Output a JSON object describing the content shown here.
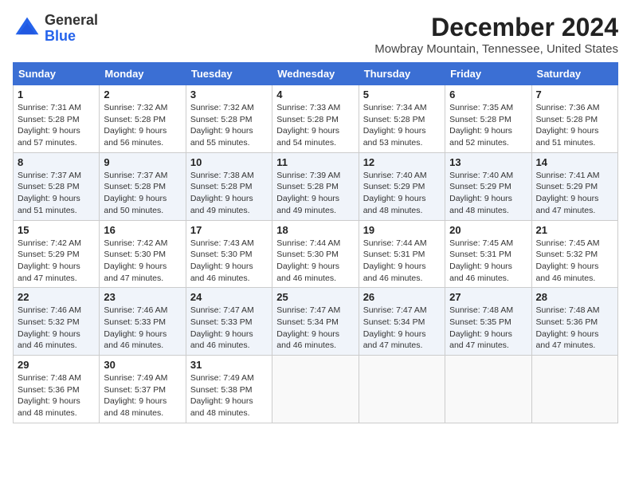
{
  "logo": {
    "general": "General",
    "blue": "Blue"
  },
  "header": {
    "month": "December 2024",
    "location": "Mowbray Mountain, Tennessee, United States"
  },
  "weekdays": [
    "Sunday",
    "Monday",
    "Tuesday",
    "Wednesday",
    "Thursday",
    "Friday",
    "Saturday"
  ],
  "weeks": [
    [
      {
        "day": "1",
        "sunrise": "7:31 AM",
        "sunset": "5:28 PM",
        "daylight": "9 hours and 57 minutes."
      },
      {
        "day": "2",
        "sunrise": "7:32 AM",
        "sunset": "5:28 PM",
        "daylight": "9 hours and 56 minutes."
      },
      {
        "day": "3",
        "sunrise": "7:32 AM",
        "sunset": "5:28 PM",
        "daylight": "9 hours and 55 minutes."
      },
      {
        "day": "4",
        "sunrise": "7:33 AM",
        "sunset": "5:28 PM",
        "daylight": "9 hours and 54 minutes."
      },
      {
        "day": "5",
        "sunrise": "7:34 AM",
        "sunset": "5:28 PM",
        "daylight": "9 hours and 53 minutes."
      },
      {
        "day": "6",
        "sunrise": "7:35 AM",
        "sunset": "5:28 PM",
        "daylight": "9 hours and 52 minutes."
      },
      {
        "day": "7",
        "sunrise": "7:36 AM",
        "sunset": "5:28 PM",
        "daylight": "9 hours and 51 minutes."
      }
    ],
    [
      {
        "day": "8",
        "sunrise": "7:37 AM",
        "sunset": "5:28 PM",
        "daylight": "9 hours and 51 minutes."
      },
      {
        "day": "9",
        "sunrise": "7:37 AM",
        "sunset": "5:28 PM",
        "daylight": "9 hours and 50 minutes."
      },
      {
        "day": "10",
        "sunrise": "7:38 AM",
        "sunset": "5:28 PM",
        "daylight": "9 hours and 49 minutes."
      },
      {
        "day": "11",
        "sunrise": "7:39 AM",
        "sunset": "5:28 PM",
        "daylight": "9 hours and 49 minutes."
      },
      {
        "day": "12",
        "sunrise": "7:40 AM",
        "sunset": "5:29 PM",
        "daylight": "9 hours and 48 minutes."
      },
      {
        "day": "13",
        "sunrise": "7:40 AM",
        "sunset": "5:29 PM",
        "daylight": "9 hours and 48 minutes."
      },
      {
        "day": "14",
        "sunrise": "7:41 AM",
        "sunset": "5:29 PM",
        "daylight": "9 hours and 47 minutes."
      }
    ],
    [
      {
        "day": "15",
        "sunrise": "7:42 AM",
        "sunset": "5:29 PM",
        "daylight": "9 hours and 47 minutes."
      },
      {
        "day": "16",
        "sunrise": "7:42 AM",
        "sunset": "5:30 PM",
        "daylight": "9 hours and 47 minutes."
      },
      {
        "day": "17",
        "sunrise": "7:43 AM",
        "sunset": "5:30 PM",
        "daylight": "9 hours and 46 minutes."
      },
      {
        "day": "18",
        "sunrise": "7:44 AM",
        "sunset": "5:30 PM",
        "daylight": "9 hours and 46 minutes."
      },
      {
        "day": "19",
        "sunrise": "7:44 AM",
        "sunset": "5:31 PM",
        "daylight": "9 hours and 46 minutes."
      },
      {
        "day": "20",
        "sunrise": "7:45 AM",
        "sunset": "5:31 PM",
        "daylight": "9 hours and 46 minutes."
      },
      {
        "day": "21",
        "sunrise": "7:45 AM",
        "sunset": "5:32 PM",
        "daylight": "9 hours and 46 minutes."
      }
    ],
    [
      {
        "day": "22",
        "sunrise": "7:46 AM",
        "sunset": "5:32 PM",
        "daylight": "9 hours and 46 minutes."
      },
      {
        "day": "23",
        "sunrise": "7:46 AM",
        "sunset": "5:33 PM",
        "daylight": "9 hours and 46 minutes."
      },
      {
        "day": "24",
        "sunrise": "7:47 AM",
        "sunset": "5:33 PM",
        "daylight": "9 hours and 46 minutes."
      },
      {
        "day": "25",
        "sunrise": "7:47 AM",
        "sunset": "5:34 PM",
        "daylight": "9 hours and 46 minutes."
      },
      {
        "day": "26",
        "sunrise": "7:47 AM",
        "sunset": "5:34 PM",
        "daylight": "9 hours and 47 minutes."
      },
      {
        "day": "27",
        "sunrise": "7:48 AM",
        "sunset": "5:35 PM",
        "daylight": "9 hours and 47 minutes."
      },
      {
        "day": "28",
        "sunrise": "7:48 AM",
        "sunset": "5:36 PM",
        "daylight": "9 hours and 47 minutes."
      }
    ],
    [
      {
        "day": "29",
        "sunrise": "7:48 AM",
        "sunset": "5:36 PM",
        "daylight": "9 hours and 48 minutes."
      },
      {
        "day": "30",
        "sunrise": "7:49 AM",
        "sunset": "5:37 PM",
        "daylight": "9 hours and 48 minutes."
      },
      {
        "day": "31",
        "sunrise": "7:49 AM",
        "sunset": "5:38 PM",
        "daylight": "9 hours and 48 minutes."
      },
      null,
      null,
      null,
      null
    ]
  ],
  "labels": {
    "sunrise": "Sunrise:",
    "sunset": "Sunset:",
    "daylight": "Daylight:"
  }
}
